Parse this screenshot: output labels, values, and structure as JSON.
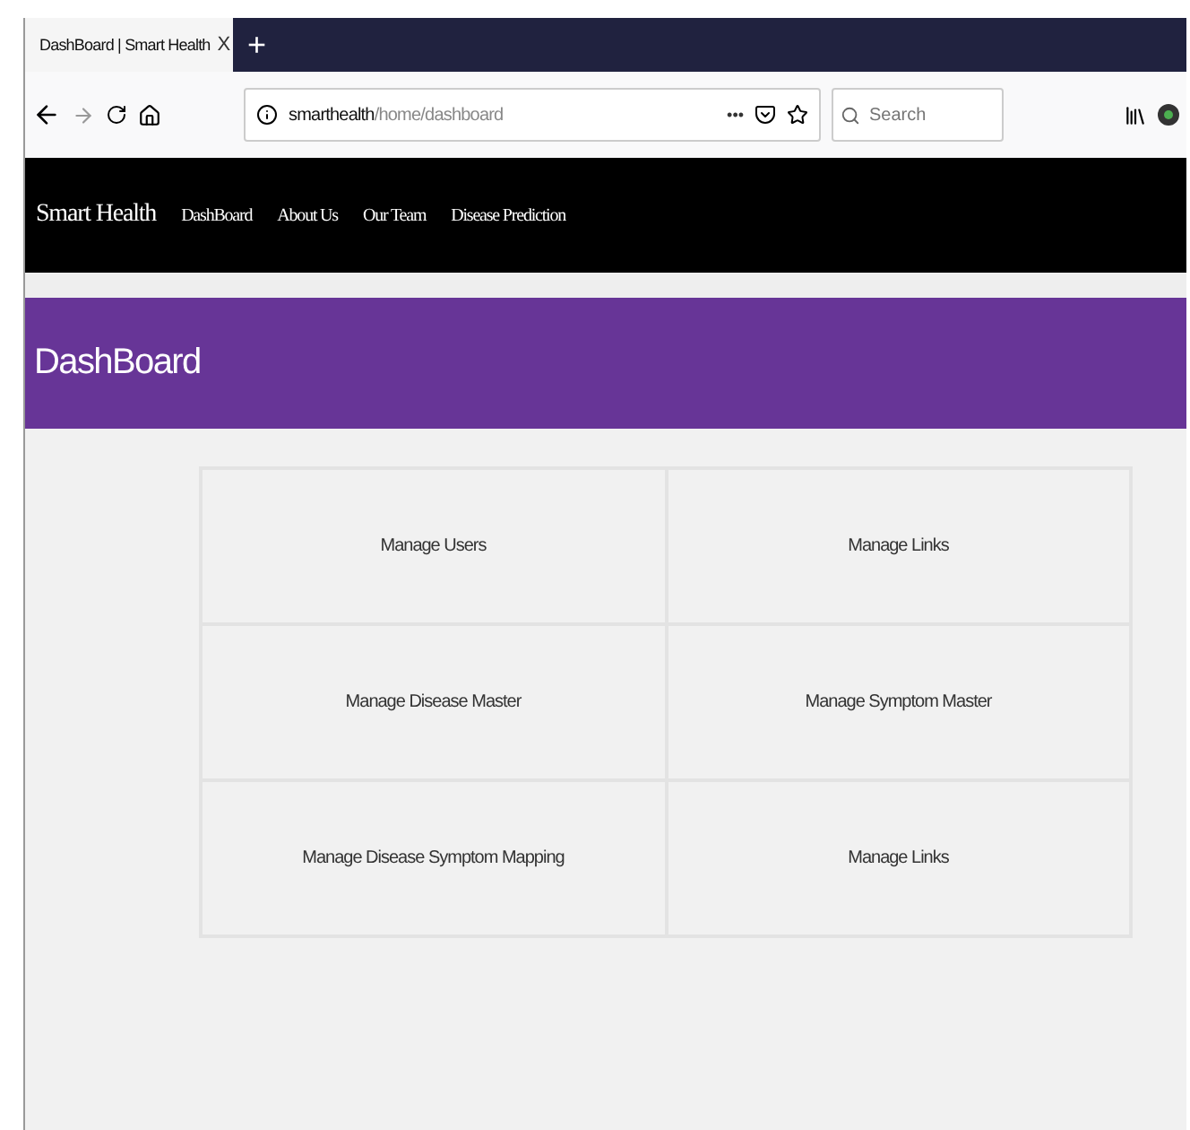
{
  "browser": {
    "tab_title": "DashBoard | Smart Health",
    "tab_close": "X",
    "new_tab": "+",
    "url_host": "smarthealth",
    "url_path": "/home/dashboard",
    "page_actions": "•••",
    "search": {
      "placeholder": "Search"
    }
  },
  "navbar": {
    "brand": "Smart Health",
    "links": [
      "DashBoard",
      "About Us",
      "Our Team",
      "Disease Prediction"
    ]
  },
  "page_header": {
    "title": "DashBoard"
  },
  "tiles": [
    "Manage Users",
    "Manage Links",
    "Manage Disease Master",
    "Manage Symptom Master",
    "Manage Disease Symptom Mapping",
    "Manage Links"
  ]
}
